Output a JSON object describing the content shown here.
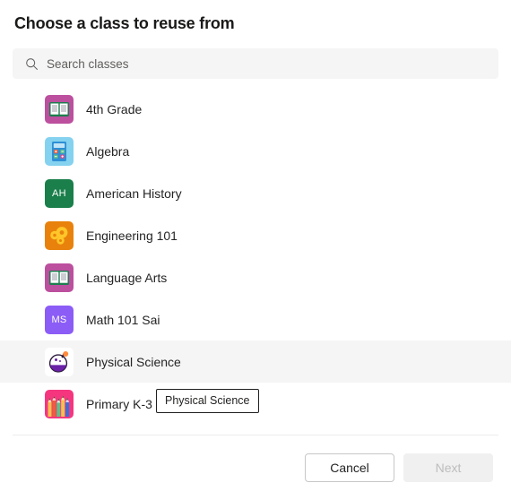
{
  "dialog": {
    "title": "Choose a class to reuse from"
  },
  "search": {
    "placeholder": "Search classes",
    "value": "",
    "icon": "search-icon"
  },
  "classes": [
    {
      "label": "4th Grade",
      "icon": "book-icon",
      "icon_bg": "#bc4f9e",
      "kind": "image"
    },
    {
      "label": "Algebra",
      "icon": "calculator-icon",
      "icon_bg": "#84d2ef",
      "kind": "image"
    },
    {
      "label": "American History",
      "icon": "initials-avatar",
      "icon_bg": "#1a7f4b",
      "kind": "initials",
      "initials": "AH"
    },
    {
      "label": "Engineering 101",
      "icon": "gears-icon",
      "icon_bg": "#e8820c",
      "kind": "image"
    },
    {
      "label": "Language Arts",
      "icon": "book-icon",
      "icon_bg": "#bc4f9e",
      "kind": "image"
    },
    {
      "label": "Math 101 Sai",
      "icon": "initials-avatar",
      "icon_bg": "#8b5cf6",
      "kind": "initials",
      "initials": "MS"
    },
    {
      "label": "Physical Science",
      "icon": "flask-icon",
      "icon_bg": "#ffffff",
      "kind": "image",
      "hovered": true
    },
    {
      "label": "Primary K-3",
      "icon": "pencils-icon",
      "icon_bg": "#f5367f",
      "kind": "image"
    }
  ],
  "tooltip": {
    "text": "Physical Science"
  },
  "footer": {
    "cancel_label": "Cancel",
    "next_label": "Next",
    "next_disabled": true
  },
  "colors": {
    "hover_row": "#f5f5f5",
    "search_bg": "#f5f5f5",
    "divider": "#ededed",
    "text": "#242424",
    "disabled_text": "#bdbdbd"
  }
}
